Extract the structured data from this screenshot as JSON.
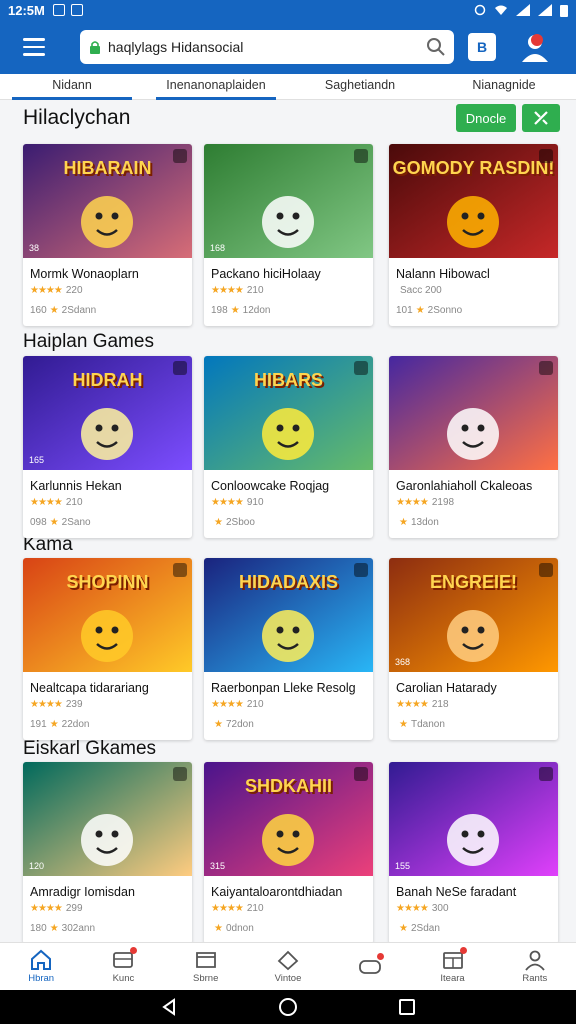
{
  "status_bar": {
    "time": "12:5М"
  },
  "search": {
    "value": "haqlylags Hidansocial"
  },
  "appbar": {
    "bookmark_label": "B"
  },
  "tabs": [
    {
      "label": "Nidann"
    },
    {
      "label": "Inenanonaplaiden"
    },
    {
      "label": "Saghetiandn"
    },
    {
      "label": "Nianagnide"
    }
  ],
  "sections": [
    {
      "title": "Hilaclychan"
    },
    {
      "title": "Haiplan Games"
    },
    {
      "title": "Kama"
    },
    {
      "title": "Eiskarl Gkames"
    }
  ],
  "buttons": {
    "primary": "Dnocle",
    "secondary_icon": "x-tools-icon"
  },
  "cards": [
    {
      "title": "Mormk Wonaoplarn",
      "stars": "★★★★",
      "rating": "220",
      "meta_left": "160",
      "meta_right": "2Sdann",
      "badge": "38",
      "art_text": "HIBARAIN"
    },
    {
      "title": "Packano hiciHolaay",
      "stars": "★★★★",
      "rating": "210",
      "meta_left": "198",
      "meta_right": "12don",
      "badge": "168",
      "art_text": ""
    },
    {
      "title": "Nalann Hibowacl",
      "stars": "",
      "rating": "Sacc 200",
      "meta_left": "101",
      "meta_right": "2Sonno",
      "badge": "",
      "art_text": "GOMODY RASDIN!"
    },
    {
      "title": "Karlunnis Hekan",
      "stars": "★★★★",
      "rating": "210",
      "meta_left": "098",
      "meta_right": "2Sano",
      "badge": "165",
      "art_text": "HIDRAH"
    },
    {
      "title": "Conloowcake Roqjag",
      "stars": "★★★★",
      "rating": "910",
      "meta_left": "",
      "meta_right": "2Sboo",
      "badge": "",
      "art_text": "HIBARS"
    },
    {
      "title": "Garonlahiaholl Ckaleoas",
      "stars": "★★★★",
      "rating": "2198",
      "meta_left": "",
      "meta_right": "13don",
      "badge": "",
      "art_text": ""
    },
    {
      "title": "Nealtcapa tidarariang",
      "stars": "★★★★",
      "rating": "239",
      "meta_left": "191",
      "meta_right": "22don",
      "badge": "",
      "art_text": "SHOPINN"
    },
    {
      "title": "Raerbonpan Lleke Resolg",
      "stars": "★★★★",
      "rating": "210",
      "meta_left": "",
      "meta_right": "72don",
      "badge": "",
      "art_text": "HIDADAXIS"
    },
    {
      "title": "Carolian Hatarady",
      "stars": "★★★★",
      "rating": "218",
      "meta_left": "",
      "meta_right": "Tdanon",
      "badge": "368",
      "art_text": "ENGREIE!"
    },
    {
      "title": "Amradigr Iomisdan",
      "stars": "★★★★",
      "rating": "299",
      "meta_left": "180",
      "meta_right": "302ann",
      "badge": "120",
      "art_text": ""
    },
    {
      "title": "Kaiyantaloarontdhiadan",
      "stars": "★★★★",
      "rating": "210",
      "meta_left": "",
      "meta_right": "0dnon",
      "badge": "315",
      "art_text": "SHDKAHII"
    },
    {
      "title": "Banah NeSe faradant",
      "stars": "★★★★",
      "rating": "300",
      "meta_left": "",
      "meta_right": "2Sdan",
      "badge": "155",
      "art_text": ""
    }
  ],
  "bottom_nav": [
    {
      "label": "Hbran",
      "icon": "home-icon"
    },
    {
      "label": "Kunc",
      "icon": "inbox-icon"
    },
    {
      "label": "Sbrne",
      "icon": "store-icon"
    },
    {
      "label": "Vintoe",
      "icon": "shape-icon"
    },
    {
      "label": "",
      "icon": "controller-icon"
    },
    {
      "label": "Iteara",
      "icon": "tools-icon"
    },
    {
      "label": "Rants",
      "icon": "profile-icon"
    }
  ],
  "colors": {
    "primary": "#1565c0",
    "accent_green": "#2fae4f",
    "star": "#f5a623",
    "alert": "#e53935"
  }
}
